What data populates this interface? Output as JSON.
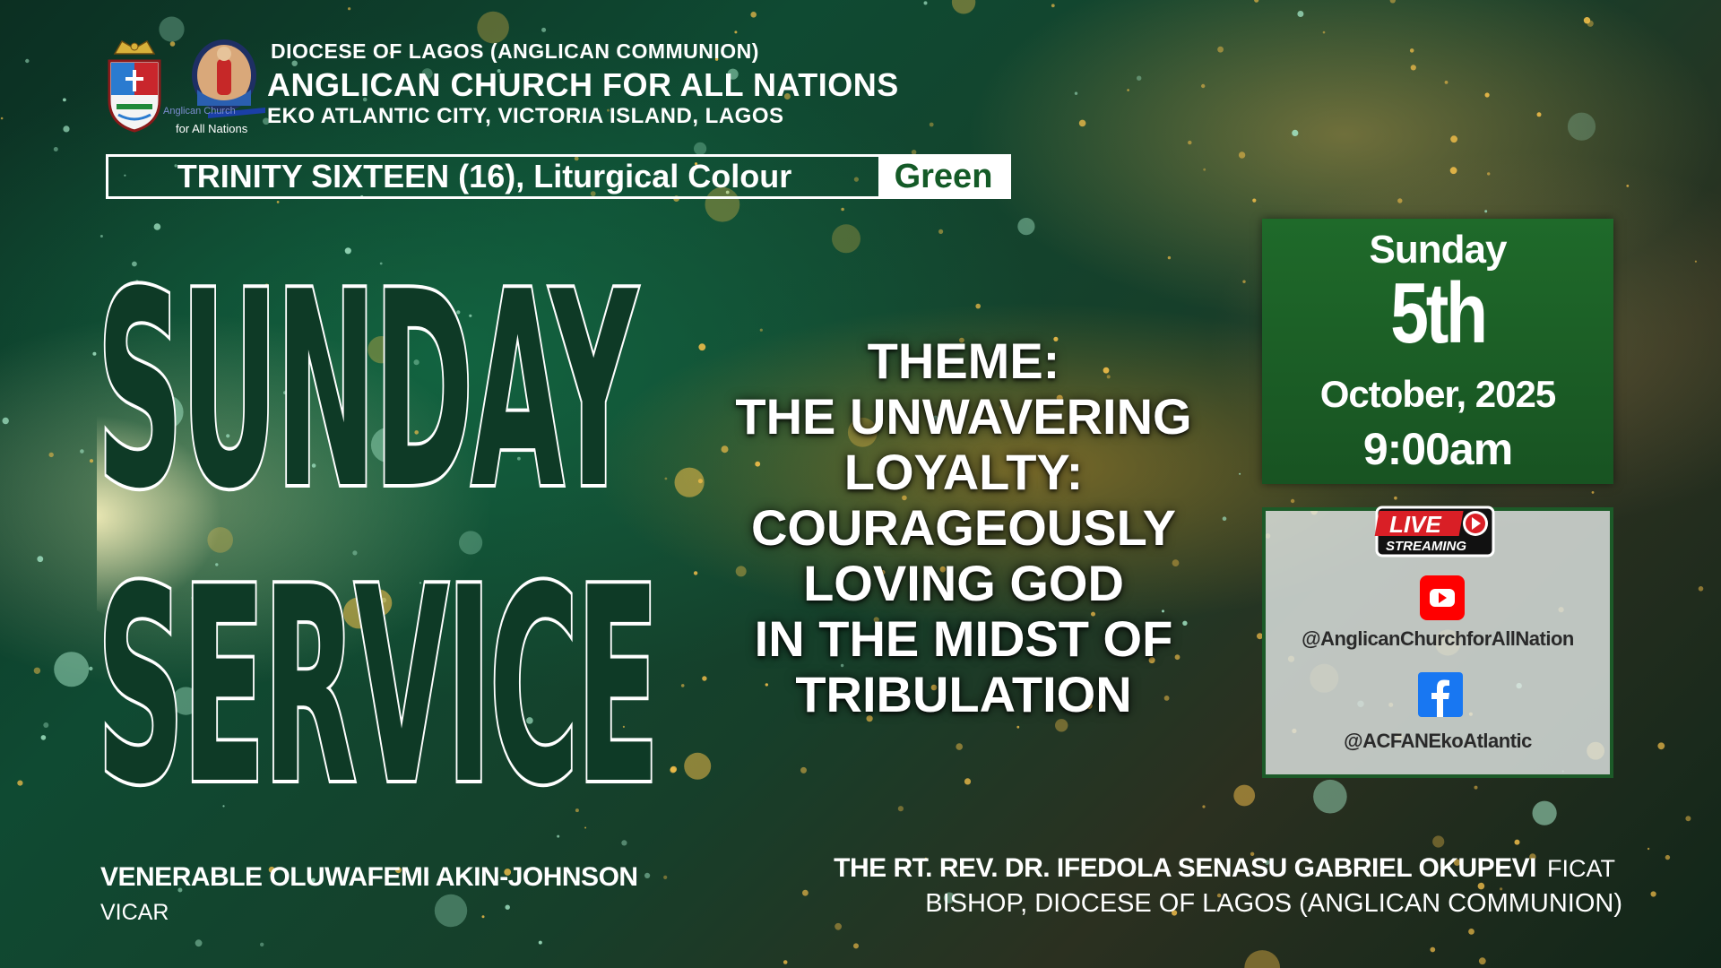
{
  "header": {
    "diocese": "DIOCESE OF LAGOS (ANGLICAN COMMUNION)",
    "church_name": "ANGLICAN CHURCH FOR ALL NATIONS",
    "address": "EKO ATLANTIC CITY, VICTORIA ISLAND, LAGOS",
    "logo_text_line1": "Anglican Church",
    "logo_text_line2": "for All Nations"
  },
  "liturgical": {
    "label": "TRINITY SIXTEEN (16), Liturgical Colour",
    "colour": "Green"
  },
  "title": {
    "line1": "SUNDAY",
    "line2": "SERVICE"
  },
  "theme": {
    "label": "THEME:",
    "lines": [
      "THE UNWAVERING",
      "LOYALTY:",
      "COURAGEOUSLY",
      "LOVING GOD",
      "IN THE MIDST OF",
      "TRIBULATION"
    ]
  },
  "event": {
    "day": "Sunday",
    "date_num": "5th",
    "month_year": "October, 2025",
    "time": "9:00am"
  },
  "streaming": {
    "live_line1": "LIVE",
    "live_line2": "STREAMING",
    "youtube_handle": "@AnglicanChurchforAllNation",
    "facebook_handle": "@ACFANEkoAtlantic"
  },
  "footer": {
    "vicar_name": "VENERABLE OLUWAFEMI AKIN-JOHNSON",
    "vicar_title": "VICAR",
    "bishop_name": "THE RT. REV. DR. IFEDOLA SENASU GABRIEL OKUPEVI",
    "bishop_suffix": "FICAT",
    "bishop_title": "BISHOP, DIOCESE OF LAGOS (ANGLICAN COMMUNION)"
  },
  "colors": {
    "accent_green": "#1f6a2a",
    "liturgical_green": "#145a27",
    "youtube_red": "#ff0000",
    "facebook_blue": "#1877f2"
  },
  "icons": [
    "diocese-crest-icon",
    "church-logo-icon",
    "live-streaming-badge-icon",
    "youtube-icon",
    "facebook-icon"
  ]
}
